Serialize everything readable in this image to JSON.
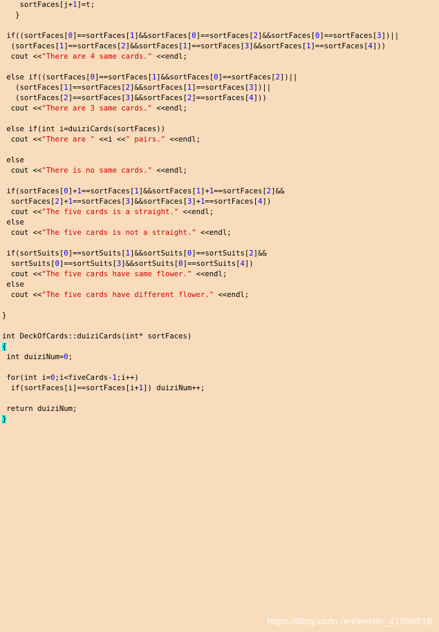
{
  "colors": {
    "background": "#f8dcbc",
    "text": "#000000",
    "number": "#0000ff",
    "string": "#d40000",
    "brace_highlight": "#00ffff",
    "watermark": "#ffffff"
  },
  "code": {
    "lines": [
      [
        {
          "t": "    sortFaces[j+"
        },
        {
          "t": "1",
          "k": "num"
        },
        {
          "t": "]=t;"
        }
      ],
      [
        {
          "t": "   }"
        }
      ],
      [],
      [
        {
          "t": " if((sortFaces["
        },
        {
          "t": "0",
          "k": "num"
        },
        {
          "t": "]==sortFaces["
        },
        {
          "t": "1",
          "k": "num"
        },
        {
          "t": "]&&sortFaces["
        },
        {
          "t": "0",
          "k": "num"
        },
        {
          "t": "]==sortFaces["
        },
        {
          "t": "2",
          "k": "num"
        },
        {
          "t": "]&&sortFaces["
        },
        {
          "t": "0",
          "k": "num"
        },
        {
          "t": "]==sortFaces["
        },
        {
          "t": "3",
          "k": "num"
        },
        {
          "t": "])||"
        }
      ],
      [
        {
          "t": "  (sortFaces["
        },
        {
          "t": "1",
          "k": "num"
        },
        {
          "t": "]==sortFaces["
        },
        {
          "t": "2",
          "k": "num"
        },
        {
          "t": "]&&sortFaces["
        },
        {
          "t": "1",
          "k": "num"
        },
        {
          "t": "]==sortFaces["
        },
        {
          "t": "3",
          "k": "num"
        },
        {
          "t": "]&&sortFaces["
        },
        {
          "t": "1",
          "k": "num"
        },
        {
          "t": "]==sortFaces["
        },
        {
          "t": "4",
          "k": "num"
        },
        {
          "t": "]))"
        }
      ],
      [
        {
          "t": "  cout <<"
        },
        {
          "t": "\"There are 4 same cards.\"",
          "k": "str"
        },
        {
          "t": " <<endl;"
        }
      ],
      [],
      [
        {
          "t": " else if((sortFaces["
        },
        {
          "t": "0",
          "k": "num"
        },
        {
          "t": "]==sortFaces["
        },
        {
          "t": "1",
          "k": "num"
        },
        {
          "t": "]&&sortFaces["
        },
        {
          "t": "0",
          "k": "num"
        },
        {
          "t": "]==sortFaces["
        },
        {
          "t": "2",
          "k": "num"
        },
        {
          "t": "])||"
        }
      ],
      [
        {
          "t": "   (sortFaces["
        },
        {
          "t": "1",
          "k": "num"
        },
        {
          "t": "]==sortFaces["
        },
        {
          "t": "2",
          "k": "num"
        },
        {
          "t": "]&&sortFaces["
        },
        {
          "t": "1",
          "k": "num"
        },
        {
          "t": "]==sortFaces["
        },
        {
          "t": "3",
          "k": "num"
        },
        {
          "t": "])||"
        }
      ],
      [
        {
          "t": "   (sortFaces["
        },
        {
          "t": "2",
          "k": "num"
        },
        {
          "t": "]==sortFaces["
        },
        {
          "t": "3",
          "k": "num"
        },
        {
          "t": "]&&sortFaces["
        },
        {
          "t": "2",
          "k": "num"
        },
        {
          "t": "]==sortFaces["
        },
        {
          "t": "4",
          "k": "num"
        },
        {
          "t": "]))"
        }
      ],
      [
        {
          "t": "  cout <<"
        },
        {
          "t": "\"There are 3 same cards.\"",
          "k": "str"
        },
        {
          "t": " <<endl;"
        }
      ],
      [],
      [
        {
          "t": " else if(int i=duiziCards(sortFaces))"
        }
      ],
      [
        {
          "t": "  cout <<"
        },
        {
          "t": "\"There are \"",
          "k": "str"
        },
        {
          "t": " <<i <<"
        },
        {
          "t": "\" pairs.\"",
          "k": "str"
        },
        {
          "t": " <<endl;"
        }
      ],
      [],
      [
        {
          "t": " else"
        }
      ],
      [
        {
          "t": "  cout <<"
        },
        {
          "t": "\"There is no same cards.\"",
          "k": "str"
        },
        {
          "t": " <<endl;"
        }
      ],
      [],
      [
        {
          "t": " if(sortFaces["
        },
        {
          "t": "0",
          "k": "num"
        },
        {
          "t": "]+"
        },
        {
          "t": "1",
          "k": "num"
        },
        {
          "t": "==sortFaces["
        },
        {
          "t": "1",
          "k": "num"
        },
        {
          "t": "]&&sortFaces["
        },
        {
          "t": "1",
          "k": "num"
        },
        {
          "t": "]+"
        },
        {
          "t": "1",
          "k": "num"
        },
        {
          "t": "==sortFaces["
        },
        {
          "t": "2",
          "k": "num"
        },
        {
          "t": "]&&"
        }
      ],
      [
        {
          "t": "  sortFaces["
        },
        {
          "t": "2",
          "k": "num"
        },
        {
          "t": "]+"
        },
        {
          "t": "1",
          "k": "num"
        },
        {
          "t": "==sortFaces["
        },
        {
          "t": "3",
          "k": "num"
        },
        {
          "t": "]&&sortFaces["
        },
        {
          "t": "3",
          "k": "num"
        },
        {
          "t": "]+"
        },
        {
          "t": "1",
          "k": "num"
        },
        {
          "t": "==sortFaces["
        },
        {
          "t": "4",
          "k": "num"
        },
        {
          "t": "])"
        }
      ],
      [
        {
          "t": "  cout <<"
        },
        {
          "t": "\"The five cards is a straight.\"",
          "k": "str"
        },
        {
          "t": " <<endl;"
        }
      ],
      [
        {
          "t": " else"
        }
      ],
      [
        {
          "t": "  cout <<"
        },
        {
          "t": "\"The five cards is not a straight.\"",
          "k": "str"
        },
        {
          "t": " <<endl;"
        }
      ],
      [],
      [
        {
          "t": " if(sortSuits["
        },
        {
          "t": "0",
          "k": "num"
        },
        {
          "t": "]==sortSuits["
        },
        {
          "t": "1",
          "k": "num"
        },
        {
          "t": "]&&sortSuits["
        },
        {
          "t": "0",
          "k": "num"
        },
        {
          "t": "]==sortSuits["
        },
        {
          "t": "2",
          "k": "num"
        },
        {
          "t": "]&&"
        }
      ],
      [
        {
          "t": "  sortSuits["
        },
        {
          "t": "0",
          "k": "num"
        },
        {
          "t": "]==sortSuits["
        },
        {
          "t": "3",
          "k": "num"
        },
        {
          "t": "]&&sortSuits["
        },
        {
          "t": "0",
          "k": "num"
        },
        {
          "t": "]==sortSuits["
        },
        {
          "t": "4",
          "k": "num"
        },
        {
          "t": "])"
        }
      ],
      [
        {
          "t": "  cout <<"
        },
        {
          "t": "\"The five cards have same flower.\"",
          "k": "str"
        },
        {
          "t": " <<endl;"
        }
      ],
      [
        {
          "t": " else"
        }
      ],
      [
        {
          "t": "  cout <<"
        },
        {
          "t": "\"The five cards have different flower.\"",
          "k": "str"
        },
        {
          "t": " <<endl;"
        }
      ],
      [],
      [
        {
          "t": "}"
        }
      ],
      [],
      [
        {
          "t": "int DeckOfCards::duiziCards(int* sortFaces)"
        }
      ],
      [
        {
          "t": "{",
          "k": "brace"
        }
      ],
      [
        {
          "t": " int duiziNum="
        },
        {
          "t": "0",
          "k": "num"
        },
        {
          "t": ";"
        }
      ],
      [],
      [
        {
          "t": " for(int i="
        },
        {
          "t": "0",
          "k": "num"
        },
        {
          "t": ";i<fiveCards-"
        },
        {
          "t": "1",
          "k": "num"
        },
        {
          "t": ";i++)"
        }
      ],
      [
        {
          "t": "  if(sortFaces[i]==sortFaces[i+"
        },
        {
          "t": "1",
          "k": "num"
        },
        {
          "t": "]) duiziNum++;"
        }
      ],
      [],
      [
        {
          "t": " return duiziNum;"
        }
      ],
      [
        {
          "t": "}",
          "k": "brace"
        }
      ]
    ]
  },
  "watermark": {
    "text": "https://blog.csdn.net/weixin_41986518"
  }
}
